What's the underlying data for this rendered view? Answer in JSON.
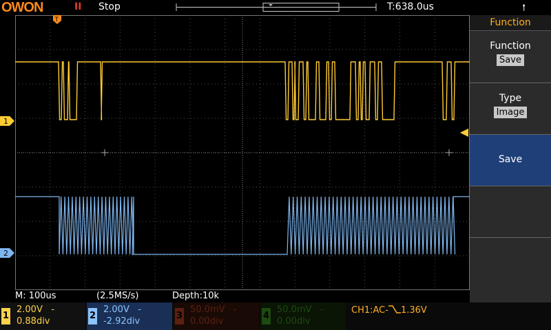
{
  "header": {
    "logo": "OWON",
    "run_indicator": "II",
    "run_state": "Stop",
    "trigger_position": "T:638.0us",
    "usb_icon": "usb-icon"
  },
  "status_bar": {
    "timebase": "M: 100us",
    "sample_rate": "(2.5MS/s)",
    "depth": "Depth:10k"
  },
  "menu": {
    "title": "Function",
    "items": [
      {
        "label": "Function",
        "value": "Save"
      },
      {
        "label": "Type",
        "value": "Image"
      },
      {
        "label": "Save",
        "value": ""
      },
      {
        "label": "",
        "value": ""
      },
      {
        "label": "",
        "value": ""
      }
    ]
  },
  "channels": [
    {
      "num": "1",
      "volts": "2.00V",
      "coupling": "-",
      "offset": "0.88div",
      "color": "#ffd24a",
      "box": "#111"
    },
    {
      "num": "2",
      "volts": "2.00V",
      "coupling": "-",
      "offset": "-2.92div",
      "color": "#8cc4ff",
      "box": "#1a2f55"
    },
    {
      "num": "3",
      "volts": "50.0mV",
      "coupling": "-",
      "offset": "0.00div",
      "color": "#5a2010",
      "box": "#1a0a05"
    },
    {
      "num": "4",
      "volts": "50.0mV",
      "coupling": "-",
      "offset": "0.00div",
      "color": "#1e4a10",
      "box": "#0a1505"
    }
  ],
  "trigger": {
    "text_pre": "CH1:AC-",
    "text_post": "1.36V"
  },
  "markers": {
    "ch1": "1",
    "ch2": "2",
    "trigger_marker": "T"
  },
  "colors": {
    "ch1": "#ffcc33",
    "ch2": "#7fb6f0",
    "accent": "#ffb020"
  }
}
